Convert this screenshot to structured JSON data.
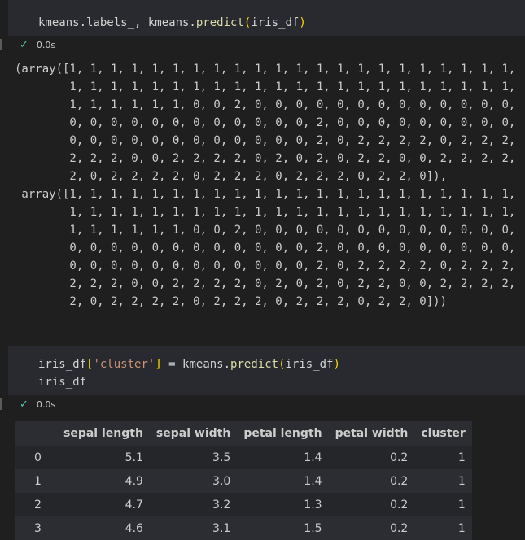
{
  "cell1": {
    "code": {
      "part1": "kmeans.labels_, kmeans.",
      "part2": "predict",
      "part3": "(",
      "part4": "iris_df",
      "part5": ")"
    },
    "status_time": "0.0s",
    "output_lines": [
      "(array([1, 1, 1, 1, 1, 1, 1, 1, 1, 1, 1, 1, 1, 1, 1, 1, 1, 1, 1, 1, 1, 1,",
      "        1, 1, 1, 1, 1, 1, 1, 1, 1, 1, 1, 1, 1, 1, 1, 1, 1, 1, 1, 1, 1, 1,",
      "        1, 1, 1, 1, 1, 1, 0, 0, 2, 0, 0, 0, 0, 0, 0, 0, 0, 0, 0, 0, 0, 0,",
      "        0, 0, 0, 0, 0, 0, 0, 0, 0, 0, 0, 0, 2, 0, 0, 0, 0, 0, 0, 0, 0, 0,",
      "        0, 0, 0, 0, 0, 0, 0, 0, 0, 0, 0, 0, 2, 0, 2, 2, 2, 2, 0, 2, 2, 2,",
      "        2, 2, 2, 0, 0, 2, 2, 2, 2, 0, 2, 0, 2, 0, 2, 2, 0, 0, 2, 2, 2, 2,",
      "        2, 0, 2, 2, 2, 2, 0, 2, 2, 2, 0, 2, 2, 2, 0, 2, 2, 0]),",
      " array([1, 1, 1, 1, 1, 1, 1, 1, 1, 1, 1, 1, 1, 1, 1, 1, 1, 1, 1, 1, 1, 1,",
      "        1, 1, 1, 1, 1, 1, 1, 1, 1, 1, 1, 1, 1, 1, 1, 1, 1, 1, 1, 1, 1, 1,",
      "        1, 1, 1, 1, 1, 1, 0, 0, 2, 0, 0, 0, 0, 0, 0, 0, 0, 0, 0, 0, 0, 0,",
      "        0, 0, 0, 0, 0, 0, 0, 0, 0, 0, 0, 0, 2, 0, 0, 0, 0, 0, 0, 0, 0, 0,",
      "        0, 0, 0, 0, 0, 0, 0, 0, 0, 0, 0, 0, 2, 0, 2, 2, 2, 2, 0, 2, 2, 2,",
      "        2, 2, 2, 0, 0, 2, 2, 2, 2, 0, 2, 0, 2, 0, 2, 2, 0, 0, 2, 2, 2, 2,",
      "        2, 0, 2, 2, 2, 2, 0, 2, 2, 2, 0, 2, 2, 2, 0, 2, 2, 0]))"
    ]
  },
  "cell2": {
    "line1": {
      "a": "iris_df",
      "b": "[",
      "c": "'cluster'",
      "d": "]",
      "e": " = kmeans.",
      "f": "predict",
      "g": "(",
      "h": "iris_df",
      "i": ")"
    },
    "line2": "iris_df",
    "status_time": "0.0s"
  },
  "table": {
    "columns": [
      "",
      "sepal length",
      "sepal width",
      "petal length",
      "petal width",
      "cluster"
    ],
    "rows": [
      [
        "0",
        "5.1",
        "3.5",
        "1.4",
        "0.2",
        "1"
      ],
      [
        "1",
        "4.9",
        "3.0",
        "1.4",
        "0.2",
        "1"
      ],
      [
        "2",
        "4.7",
        "3.2",
        "1.3",
        "0.2",
        "1"
      ],
      [
        "3",
        "4.6",
        "3.1",
        "1.5",
        "0.2",
        "1"
      ]
    ]
  },
  "colors": {
    "background": "#1f1f1f",
    "cell_background": "#282a2f",
    "function": "#dcdcaa",
    "bracket": "#ffd700",
    "string": "#ce9178",
    "success_check": "#4ec9b0"
  },
  "icons": {
    "status_icon": "checkmark-icon"
  }
}
